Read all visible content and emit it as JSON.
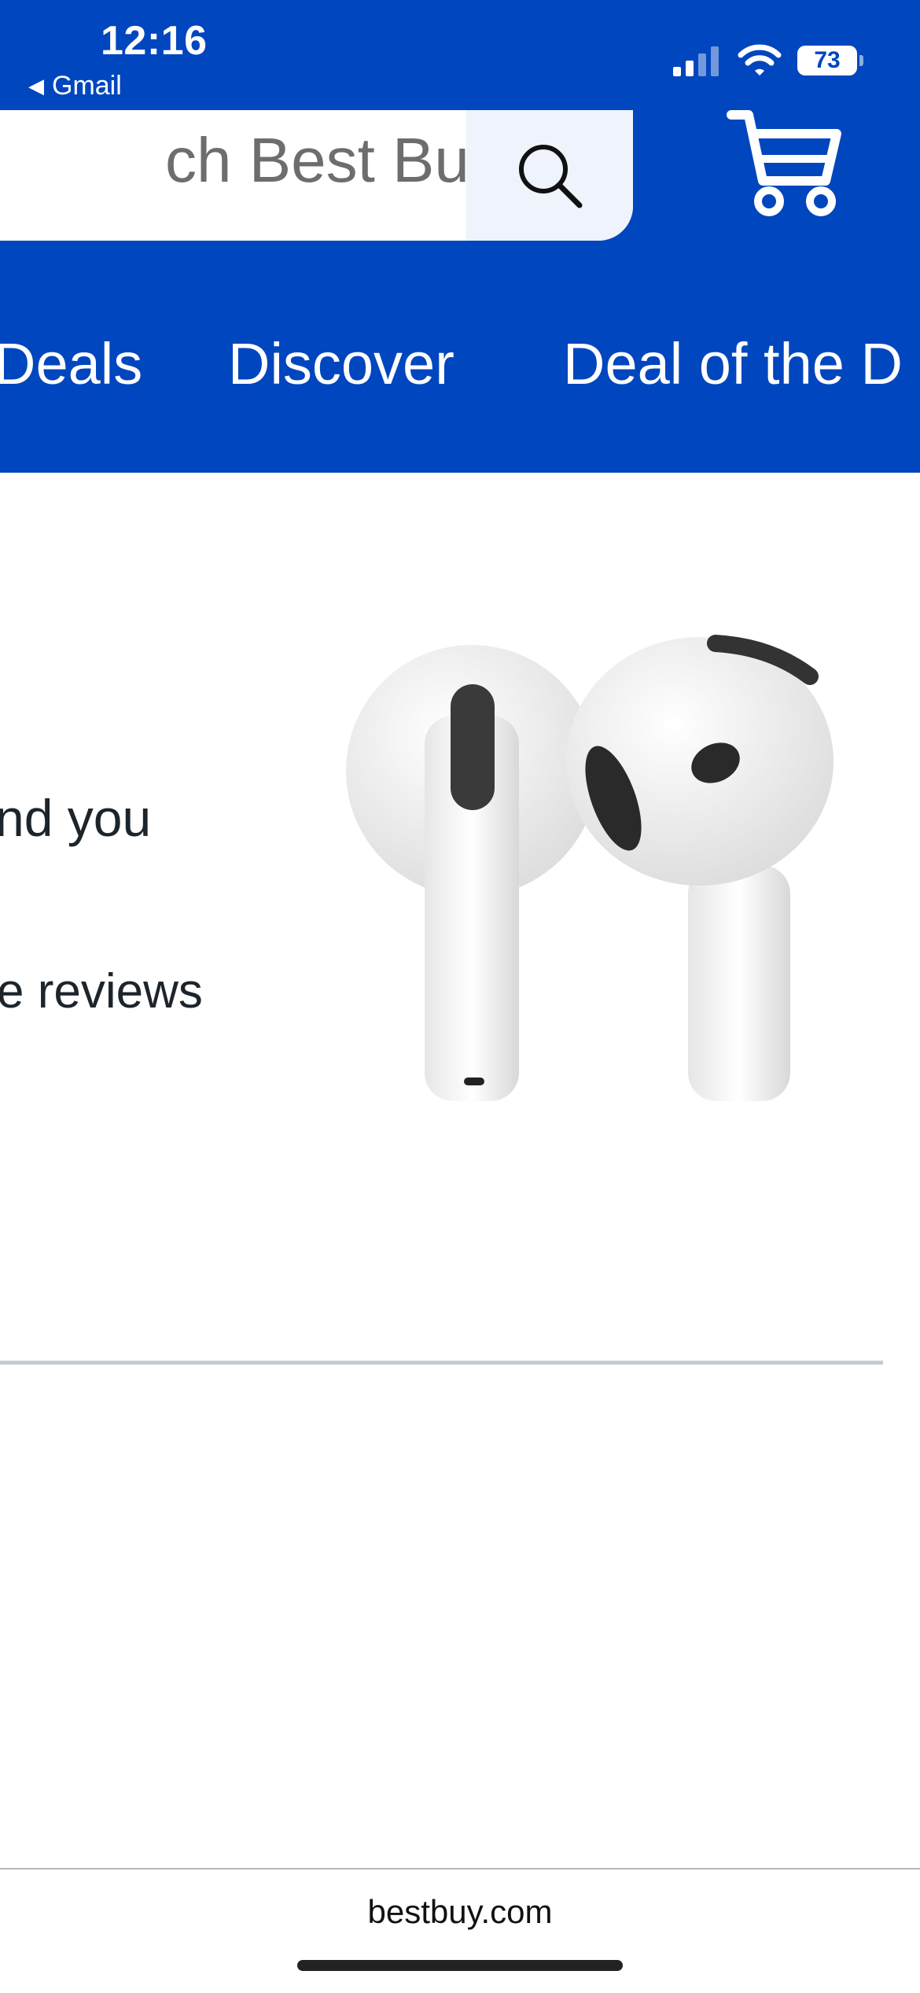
{
  "status_bar": {
    "time": "12:16",
    "back_app": "Gmail",
    "battery": "73",
    "icons": [
      "signal-icon",
      "wifi-icon",
      "battery-icon"
    ]
  },
  "header": {
    "search_placeholder": "Search Best Buy",
    "search_visible_text": "ch Best Buy",
    "nav_items": [
      "Deals",
      "Discover",
      "Deal of the D"
    ]
  },
  "hero": {
    "line1": "nd you",
    "line2": "e reviews",
    "image": "airpods-product-image"
  },
  "browser": {
    "url": "bestbuy.com"
  },
  "colors": {
    "brand_blue": "#0046be",
    "text_dark": "#1d252c",
    "divider": "#c5cbd5"
  }
}
